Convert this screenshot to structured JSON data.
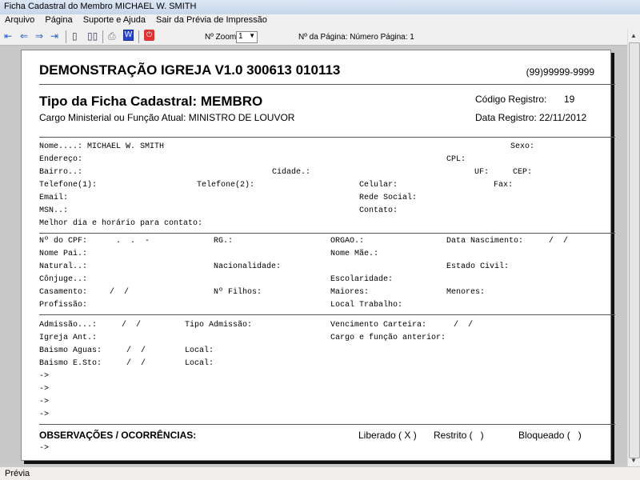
{
  "window": {
    "title": "Ficha Cadastral do Membro MICHAEL W. SMITH"
  },
  "menu": [
    "Arquivo",
    "Página",
    "Suporte e Ajuda",
    "Sair da Prévia de Impressão"
  ],
  "toolbar": {
    "zoom_label": "Nº Zoom",
    "zoom_value": "1",
    "page_label": "Nº da Página: Número Página: 1"
  },
  "status": "Prévia",
  "report": {
    "org": "DEMONSTRAÇÃO IGREJA V1.0 300613 010113",
    "phone": "(99)99999-9999",
    "tipo": "Tipo da Ficha Cadastral: MEMBRO",
    "cargo": "Cargo Ministerial ou Função Atual: MINISTRO DE LOUVOR",
    "codigo_label": "Código Registro:",
    "codigo": "19",
    "data_registro": "Data Registro: 22/11/2012",
    "s1": {
      "nome": "Nome....: MICHAEL W. SMITH",
      "sexo": "Sexo:",
      "endereco": "Endereço:",
      "cpl": "CPL:",
      "bairro": "Bairro..:",
      "cidade": "Cidade.:",
      "uf": "UF:",
      "cep": "CEP:",
      "tel1": "Telefone(1):",
      "tel2": "Telefone(2):",
      "celular": "Celular:",
      "fax": "Fax:",
      "email": "Email:",
      "rede": "Rede Social:",
      "msn": "MSN..:",
      "contato": "Contato:",
      "melhor": "Melhor dia e horário para contato:"
    },
    "s2": {
      "cpf": "Nº do CPF:",
      "cpf_mask": ".  .  -",
      "rg": "RG.:",
      "orgao": "ORGAO.:",
      "nasc": "Data Nascimento:",
      "nasc_val": "/  /",
      "pai": "Nome Pai.:",
      "mae": "Nome Mãe.:",
      "natural": "Natural..:",
      "nacionalidade": "Nacionalidade:",
      "estado_civil": "Estado Civil:",
      "conjuge": "Cônjuge..:",
      "escolaridade": "Escolaridade:",
      "casamento": "Casamento:",
      "casamento_val": "/  /",
      "filhos": "Nº Filhos:",
      "maiores": "Maiores:",
      "menores": "Menores:",
      "profissao": "Profissão:",
      "local_trabalho": "Local Trabalho:"
    },
    "s3": {
      "admissao": "Admissão...:",
      "admissao_val": "/  /",
      "tipo_admissao": "Tipo Admissão:",
      "vencimento": "Vencimento Carteira:",
      "vencimento_val": "/  /",
      "igreja_ant": "Igreja Ant.:",
      "cargo_ant": "Cargo e função anterior:",
      "bat_aguas": "Baismo Aguas:",
      "bat_aguas_val": "/  /",
      "local1": "Local:",
      "bat_esto": "Baismo E.Sto:",
      "bat_esto_val": "/  /",
      "local2": "Local:",
      "arrows": [
        "->",
        "->",
        "->",
        "->"
      ]
    },
    "obs": {
      "title": "OBSERVAÇÕES / OCORRÊNCIAS:",
      "liberado": "Liberado ( X )",
      "restrito": "Restrito (   )",
      "bloqueado": "Bloqueado (   )",
      "arrow": "->"
    }
  }
}
